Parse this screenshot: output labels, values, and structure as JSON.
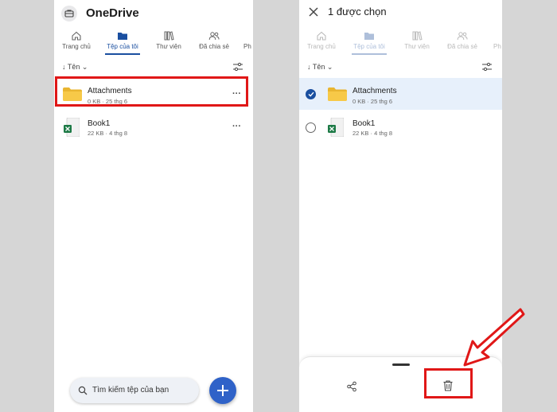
{
  "left_screen": {
    "app_title": "OneDrive",
    "tabs": [
      {
        "label": "Trang chủ",
        "icon": "home-icon",
        "active": false
      },
      {
        "label": "Tệp của tôi",
        "icon": "folder-icon",
        "active": true
      },
      {
        "label": "Thư viện",
        "icon": "library-icon",
        "active": false
      },
      {
        "label": "Đã chia sẻ",
        "icon": "people-icon",
        "active": false
      },
      {
        "label": "Ph",
        "icon": "",
        "active": false
      }
    ],
    "sort_label": "↓ Tên ⌄",
    "files": [
      {
        "name": "Attachments",
        "meta": "0 KB · 25 thg 6",
        "type": "folder"
      },
      {
        "name": "Book1",
        "meta": "22 KB · 4 thg 8",
        "type": "excel"
      }
    ],
    "search_placeholder": "Tìm kiếm tệp của bạn",
    "more_glyph": "···"
  },
  "right_screen": {
    "selection_title": "1 được chọn",
    "tabs": [
      {
        "label": "Trang chủ",
        "icon": "home-icon",
        "active": false
      },
      {
        "label": "Tệp của tôi",
        "icon": "folder-icon",
        "active": true
      },
      {
        "label": "Thư viện",
        "icon": "library-icon",
        "active": false
      },
      {
        "label": "Đã chia sẻ",
        "icon": "people-icon",
        "active": false
      },
      {
        "label": "Ph",
        "icon": "",
        "active": false
      }
    ],
    "sort_label": "↓ Tên ⌄",
    "files": [
      {
        "name": "Attachments",
        "meta": "0 KB · 25 thg 6",
        "type": "folder",
        "selected": true
      },
      {
        "name": "Book1",
        "meta": "22 KB · 4 thg 8",
        "type": "excel",
        "selected": false
      }
    ],
    "sheet_actions": [
      "share-icon",
      "trash-icon"
    ]
  },
  "colors": {
    "accent": "#1a4fa0",
    "fab": "#2f62c8",
    "highlight": "#e01717",
    "folder": "#f7c948",
    "excel": "#1d7a46",
    "selected_row": "#e7f0fb"
  }
}
